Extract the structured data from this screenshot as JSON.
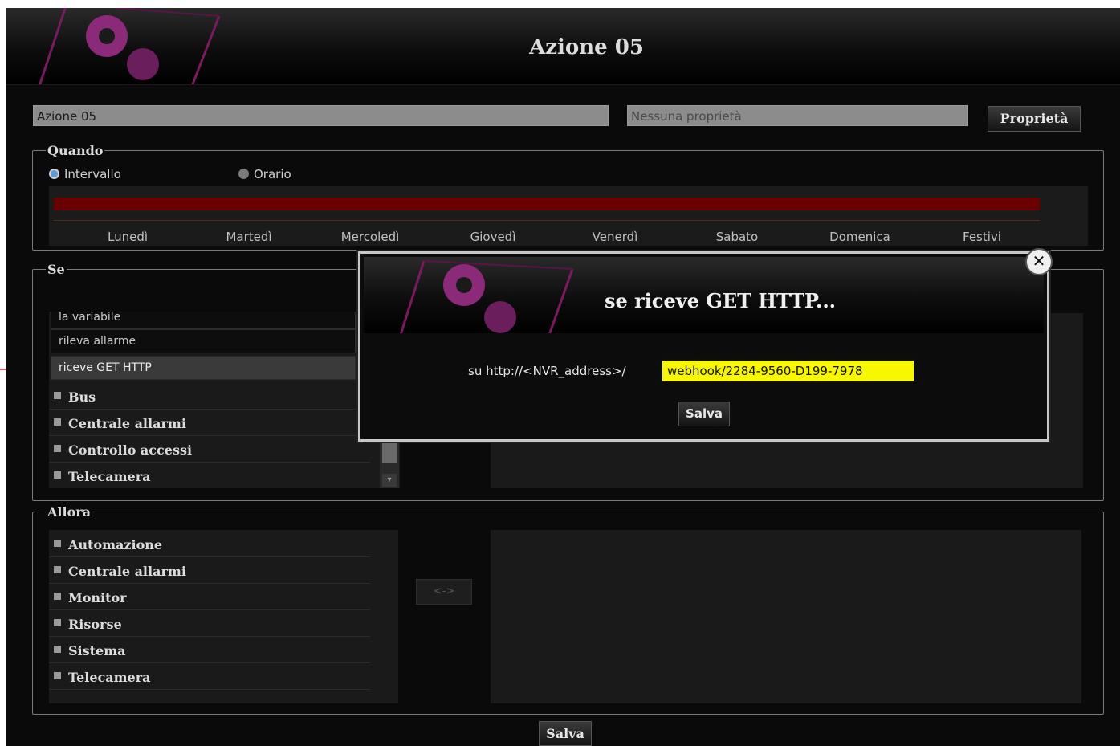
{
  "header": {
    "title": "Azione 05"
  },
  "name_field": {
    "value": "Azione 05"
  },
  "property_field": {
    "placeholder": "Nessuna proprietà"
  },
  "property_button": "Proprietà",
  "quando": {
    "legend": "Quando",
    "radio_interval": "Intervallo",
    "radio_schedule": "Orario",
    "selected": "Intervallo",
    "days": [
      "Lunedì",
      "Martedì",
      "Mercoledì",
      "Giovedì",
      "Venerdì",
      "Sabato",
      "Domenica",
      "Festivi"
    ]
  },
  "se": {
    "legend": "Se",
    "sub_items": [
      "la variabile",
      "rileva allarme",
      "riceve GET HTTP"
    ],
    "selected_sub": "riceve GET HTTP",
    "groups": [
      "Bus",
      "Centrale allarmi",
      "Controllo accessi",
      "Telecamera"
    ]
  },
  "allora": {
    "legend": "Allora",
    "groups": [
      "Automazione",
      "Centrale allarmi",
      "Monitor",
      "Risorse",
      "Sistema",
      "Telecamera"
    ],
    "swap_button": "<->"
  },
  "save_button": "Salva",
  "modal": {
    "title": "se riceve GET HTTP...",
    "label": "su http://<NVR_address>/",
    "value": "webhook/2284-9560-D199-7978",
    "save_button": "Salva",
    "close_icon": "close-icon"
  },
  "colors": {
    "accent_magenta": "#b0288a",
    "timeline_red": "#6a0000",
    "highlight_yellow": "#f7f700",
    "arrow_red": "#e0201c"
  }
}
